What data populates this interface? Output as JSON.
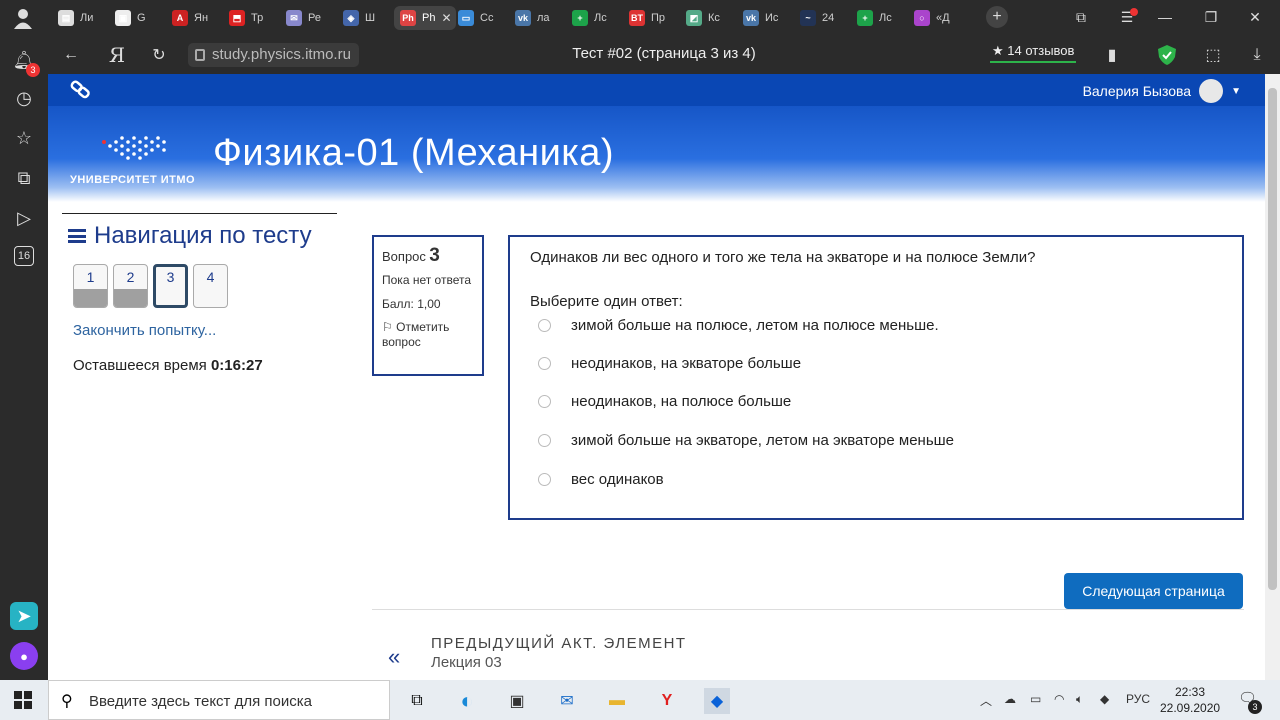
{
  "browser": {
    "tabs": [
      {
        "label": "Ли",
        "color": "#ddd",
        "glyph": "▤"
      },
      {
        "label": "G",
        "color": "#eee",
        "glyph": "▣"
      },
      {
        "label": "Ян",
        "color": "#c22",
        "glyph": "A"
      },
      {
        "label": "Тр",
        "color": "#d22",
        "glyph": "⬒"
      },
      {
        "label": "Ре",
        "color": "#88c",
        "glyph": "✉"
      },
      {
        "label": "Ш",
        "color": "#46a",
        "glyph": "◈"
      },
      {
        "label": "Ph",
        "color": "#d44",
        "glyph": "Ph",
        "active": true
      },
      {
        "label": "Сс",
        "color": "#3a8bd8",
        "glyph": "▭"
      },
      {
        "label": "ла",
        "color": "#4a76a8",
        "glyph": "vk"
      },
      {
        "label": "Лс",
        "color": "#1da34a",
        "glyph": "+"
      },
      {
        "label": "Пр",
        "color": "#d33",
        "glyph": "BT"
      },
      {
        "label": "Кс",
        "color": "#5a8",
        "glyph": "◩"
      },
      {
        "label": "Ис",
        "color": "#4a76a8",
        "glyph": "vk"
      },
      {
        "label": "24",
        "color": "#235",
        "glyph": "~"
      },
      {
        "label": "Лс",
        "color": "#1da34a",
        "glyph": "+"
      },
      {
        "label": "«Д",
        "color": "#a4c",
        "glyph": "○"
      }
    ],
    "url": "study.physics.itmo.ru",
    "page_title": "Тест #02 (страница 3 из 4)",
    "reviews": "★ 14 отзывов",
    "notification_count": "3",
    "sidebar_counter": "16"
  },
  "site": {
    "user_name": "Валерия Бызова",
    "logo_text": "УНИВЕРСИТЕТ ИТМО",
    "course_title": "Физика-01 (Механика)"
  },
  "quiz_nav": {
    "title": "Навигация по тесту",
    "questions": [
      "1",
      "2",
      "3",
      "4"
    ],
    "finish_link": "Закончить попытку...",
    "timer_label": "Оставшееся время",
    "timer_value": "0:16:27"
  },
  "question": {
    "label": "Вопрос",
    "number": "3",
    "state": "Пока нет ответа",
    "score": "Балл: 1,00",
    "flag": "Отметить вопрос",
    "text": "Одинаков ли вес одного и того же тела на экваторе и на полюсе Земли?",
    "prompt": "Выберите один ответ:",
    "answers": [
      "зимой больше на полюсе, летом на полюсе меньше.",
      "неодинаков, на экваторе больше",
      "неодинаков, на полюсе больше",
      "зимой больше на экваторе, летом на экваторе меньше",
      "вес одинаков"
    ]
  },
  "footer": {
    "next_button": "Следующая страница",
    "prev_label": "ПРЕДЫДУЩИЙ АКТ. ЭЛЕМЕНТ",
    "prev_name": "Лекция 03"
  },
  "taskbar": {
    "search_placeholder": "Введите здесь текст для поиска",
    "lang": "РУС",
    "time": "22:33",
    "date": "22.09.2020",
    "notif_count": "3"
  }
}
